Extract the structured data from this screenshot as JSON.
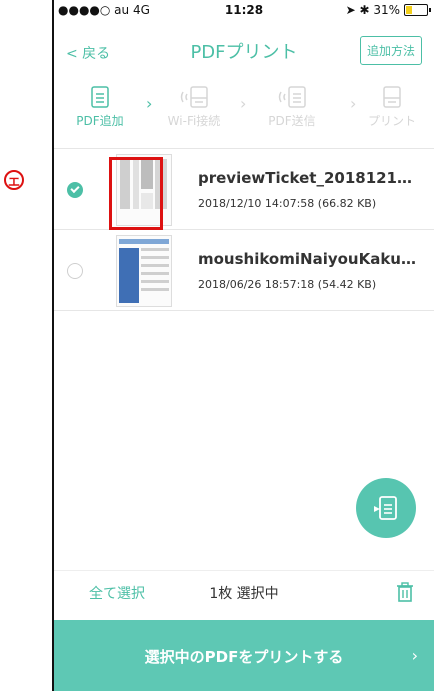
{
  "status_bar": {
    "carrier": "●●●●○ au 4G",
    "time": "11:28",
    "right": "➤ ✱ 31%",
    "battery_level": 0.31
  },
  "nav": {
    "back_label": "< 戻る",
    "title": "PDFプリント",
    "howto_label": "追加方法"
  },
  "steps": [
    {
      "label": "PDF追加",
      "state": "active"
    },
    {
      "label": "Wi-Fi接続",
      "state": "inactive"
    },
    {
      "label": "PDF送信",
      "state": "inactive"
    },
    {
      "label": "プリント",
      "state": "inactive"
    }
  ],
  "files": [
    {
      "name": "previewTicket_2018121…",
      "meta": "2018/12/10 14:07:58 (66.82 KB)",
      "selected": true
    },
    {
      "name": "moushikomiNaiyouKaku…",
      "meta": "2018/06/26 18:57:18 (54.42 KB)",
      "selected": false
    }
  ],
  "annotation_marker": "エ",
  "bottom": {
    "select_all_label": "全て選択",
    "selection_count": "1枚 選択中"
  },
  "print_button": {
    "label": "選択中のPDFをプリントする",
    "arrow": "›"
  },
  "colors": {
    "accent": "#4cbfa6",
    "print_bar": "#5ec8b4",
    "highlight": "#dd1111",
    "inactive": "#d6d6d6"
  },
  "icons": [
    "document-icon",
    "wifi-printer-icon",
    "wifi-document-icon",
    "printer-icon",
    "chevron-right-icon",
    "add-pdf-icon",
    "trash-icon"
  ]
}
